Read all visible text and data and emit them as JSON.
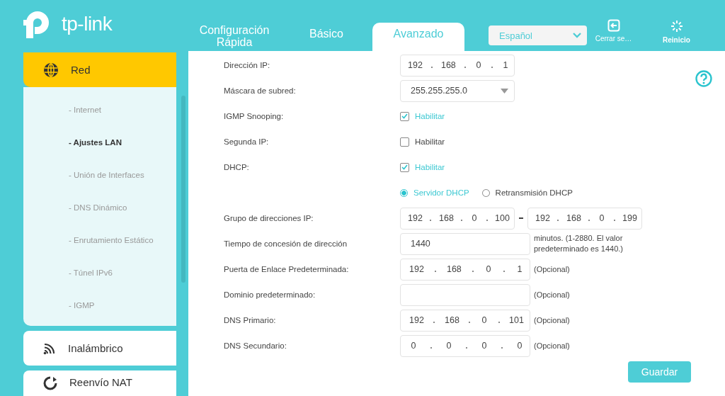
{
  "logo": {
    "text": "tp-link"
  },
  "tabs": [
    {
      "label": "Configuración Rápida",
      "selected": false
    },
    {
      "label": "Básico",
      "selected": false
    },
    {
      "label": "Avanzado",
      "selected": true
    }
  ],
  "language": {
    "value": "Español"
  },
  "header_buttons": [
    {
      "kind": "logout",
      "label": "Cerrar se…"
    },
    {
      "kind": "reboot",
      "label": "Reinicio"
    }
  ],
  "sidebar": [
    {
      "kind": "globe",
      "label": "Red",
      "selected": true,
      "expanded": true,
      "children": [
        {
          "label": "- Internet",
          "selected": false
        },
        {
          "label": "- Ajustes LAN",
          "selected": true
        },
        {
          "label": "- Unión de Interfaces",
          "selected": false
        },
        {
          "label": "- DNS Dinámico",
          "selected": false
        },
        {
          "label": "- Enrutamiento Estático",
          "selected": false
        },
        {
          "label": "- Túnel IPv6",
          "selected": false
        },
        {
          "label": "- IGMP",
          "selected": false
        }
      ]
    },
    {
      "kind": "wifi",
      "label": "Inalámbrico",
      "selected": false
    },
    {
      "kind": "nat",
      "label": "Reenvío NAT",
      "selected": false
    }
  ],
  "form": [
    {
      "kind": "ip",
      "label": "Dirección IP:",
      "octets": [
        "192",
        "168",
        "0",
        "1"
      ]
    },
    {
      "kind": "select",
      "label": "Máscara de subred:",
      "value": "255.255.255.0"
    },
    {
      "kind": "checkbox",
      "label": "IGMP Snooping:",
      "option": "Habilitar",
      "checked": true
    },
    {
      "kind": "checkbox",
      "label": "Segunda IP:",
      "option": "Habilitar",
      "checked": false
    },
    {
      "kind": "checkbox",
      "label": "DHCP:",
      "option": "Habilitar",
      "checked": true
    },
    {
      "kind": "radio",
      "options": [
        {
          "label": "Servidor DHCP",
          "selected": true
        },
        {
          "label": "Retransmisión DHCP",
          "selected": false
        }
      ]
    },
    {
      "kind": "range",
      "label": "Grupo de direcciones IP:",
      "start": [
        "192",
        "168",
        "0",
        "100"
      ],
      "end": [
        "192",
        "168",
        "0",
        "199"
      ]
    },
    {
      "kind": "text",
      "label": "Tiempo de concesión de dirección",
      "value": "1440",
      "note": "minutos. (1-2880. El valor predeterminado es 1440.)"
    },
    {
      "kind": "ip",
      "label": "Puerta de Enlace Predeterminada:",
      "octets": [
        "192",
        "168",
        "0",
        "1"
      ],
      "note": "(Opcional)"
    },
    {
      "kind": "text",
      "label": "Dominio predeterminado:",
      "note": "(Opcional)"
    },
    {
      "kind": "ip",
      "label": "DNS Primario:",
      "octets": [
        "192",
        "168",
        "0",
        "101"
      ],
      "note": "(Opcional)"
    },
    {
      "kind": "ip",
      "label": "DNS Secundario:",
      "octets": [
        "0",
        "0",
        "0",
        "0"
      ],
      "note": "(Opcional)"
    }
  ],
  "save_button": {
    "label": "Guardar"
  }
}
